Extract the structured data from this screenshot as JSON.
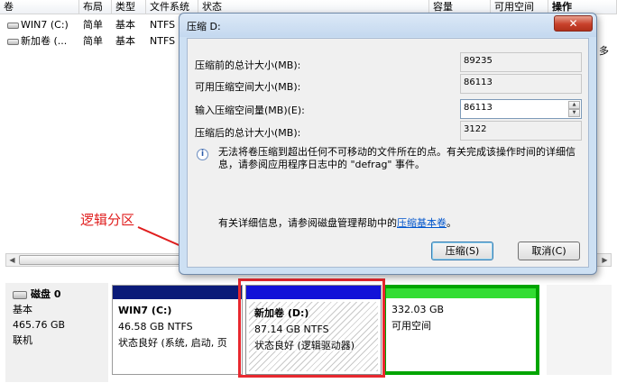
{
  "volume_list": {
    "headers": [
      "卷",
      "布局",
      "类型",
      "文件系统",
      "状态",
      "容量",
      "可用空间",
      "操作"
    ],
    "rows": [
      {
        "name": "WIN7 (C:)",
        "layout": "简单",
        "type": "基本",
        "fs": "NTFS"
      },
      {
        "name": "新加卷 (...",
        "layout": "简单",
        "type": "基本",
        "fs": "NTFS"
      }
    ],
    "side_label": "多"
  },
  "disk": {
    "name": "磁盘 0",
    "type": "基本",
    "size": "465.76 GB",
    "status": "联机"
  },
  "partitions": {
    "c": {
      "name": "WIN7  (C:)",
      "size": "46.58 GB NTFS",
      "status": "状态良好 (系统, 启动, 页"
    },
    "d": {
      "name": "新加卷  (D:)",
      "size": "87.14 GB NTFS",
      "status": "状态良好 (逻辑驱动器)"
    },
    "free": {
      "size": "332.03 GB",
      "status": "可用空间"
    }
  },
  "annotation": {
    "text": "逻辑分区",
    "color": "#e01e1e"
  },
  "dialog": {
    "title": "压缩 D:",
    "close_glyph": "✕",
    "fields": {
      "total_before_label": "压缩前的总计大小(MB):",
      "total_before_value": "89235",
      "available_label": "可用压缩空间大小(MB):",
      "available_value": "86113",
      "input_label": "输入压缩空间量(MB)(E):",
      "input_value": "86113",
      "total_after_label": "压缩后的总计大小(MB):",
      "total_after_value": "3122"
    },
    "info_text": "无法将卷压缩到超出任何不可移动的文件所在的点。有关完成该操作时间的详细信息，请参阅应用程序日志中的 \"defrag\" 事件。",
    "help_text": "有关详细信息，请参阅磁盘管理帮助中的",
    "help_link": "压缩基本卷",
    "help_suffix": "。",
    "buttons": {
      "shrink": "压缩(S)",
      "cancel": "取消(C)"
    }
  },
  "colors": {
    "primary_partition": "#0a1a78",
    "logical_partition": "#1212d8",
    "free_space": "#33dd33",
    "highlight": "#e8282f"
  }
}
